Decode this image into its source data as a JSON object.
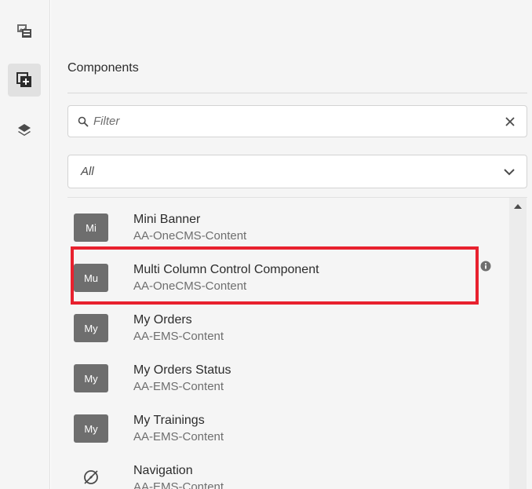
{
  "panel": {
    "title": "Components"
  },
  "filter": {
    "placeholder": "Filter",
    "value": ""
  },
  "group_select": {
    "selected": "All"
  },
  "components": [
    {
      "abbr": "Mi",
      "title": "Mini Banner",
      "group": "AA-OneCMS-Content",
      "icon": null
    },
    {
      "abbr": "Mu",
      "title": "Multi Column Control Component",
      "group": "AA-OneCMS-Content",
      "icon": null
    },
    {
      "abbr": "My",
      "title": "My Orders",
      "group": "AA-EMS-Content",
      "icon": null
    },
    {
      "abbr": "My",
      "title": "My Orders Status",
      "group": "AA-EMS-Content",
      "icon": null
    },
    {
      "abbr": "My",
      "title": "My Trainings",
      "group": "AA-EMS-Content",
      "icon": null
    },
    {
      "abbr": "",
      "title": "Navigation",
      "group": "AA-EMS-Content",
      "icon": "compass-icon"
    }
  ],
  "colors": {
    "highlight": "#e8212e",
    "avatar": "#6e6e6e"
  }
}
